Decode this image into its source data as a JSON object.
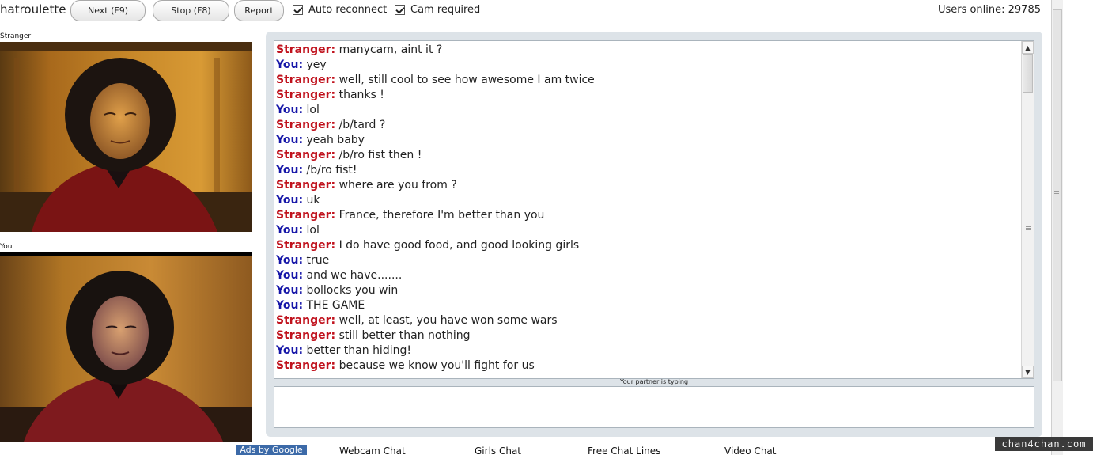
{
  "header": {
    "brand": "hatroulette",
    "next_label": "Next (F9)",
    "stop_label": "Stop (F8)",
    "report_label": "Report",
    "auto_reconnect_label": "Auto reconnect",
    "cam_required_label": "Cam required",
    "users_online": "Users online: 29785"
  },
  "video": {
    "stranger_label": "Stranger",
    "you_label": "You"
  },
  "chat": {
    "messages": [
      {
        "who": "Stranger:",
        "text": "manycam, aint it ?"
      },
      {
        "who": "You:",
        "text": "yey"
      },
      {
        "who": "Stranger:",
        "text": "well, still cool to see how awesome I am twice"
      },
      {
        "who": "Stranger:",
        "text": "thanks !"
      },
      {
        "who": "You:",
        "text": "lol"
      },
      {
        "who": "Stranger:",
        "text": "/b/tard ?"
      },
      {
        "who": "You:",
        "text": "yeah baby"
      },
      {
        "who": "Stranger:",
        "text": "/b/ro fist then !"
      },
      {
        "who": "You:",
        "text": "/b/ro fist!"
      },
      {
        "who": "Stranger:",
        "text": "where are you from ?"
      },
      {
        "who": "You:",
        "text": "uk"
      },
      {
        "who": "Stranger:",
        "text": "France, therefore I'm better than you"
      },
      {
        "who": "You:",
        "text": "lol"
      },
      {
        "who": "Stranger:",
        "text": "I do have good food, and good looking girls"
      },
      {
        "who": "You:",
        "text": "true"
      },
      {
        "who": "You:",
        "text": "and we have......."
      },
      {
        "who": "You:",
        "text": "bollocks you win"
      },
      {
        "who": "You:",
        "text": "THE GAME"
      },
      {
        "who": "Stranger:",
        "text": "well, at least, you have won some wars"
      },
      {
        "who": "Stranger:",
        "text": "still better than nothing"
      },
      {
        "who": "You:",
        "text": "better than hiding!"
      },
      {
        "who": "Stranger:",
        "text": "because we know you'll fight for us"
      }
    ],
    "typing_status": "Your partner is typing",
    "colors": {
      "stranger": "#c0121d",
      "you": "#1616a8"
    }
  },
  "footer": {
    "ads_label": "Ads by Google",
    "links": [
      "Webcam Chat",
      "Girls Chat",
      "Free Chat Lines",
      "Video Chat"
    ]
  },
  "watermark": "chan4chan.com"
}
